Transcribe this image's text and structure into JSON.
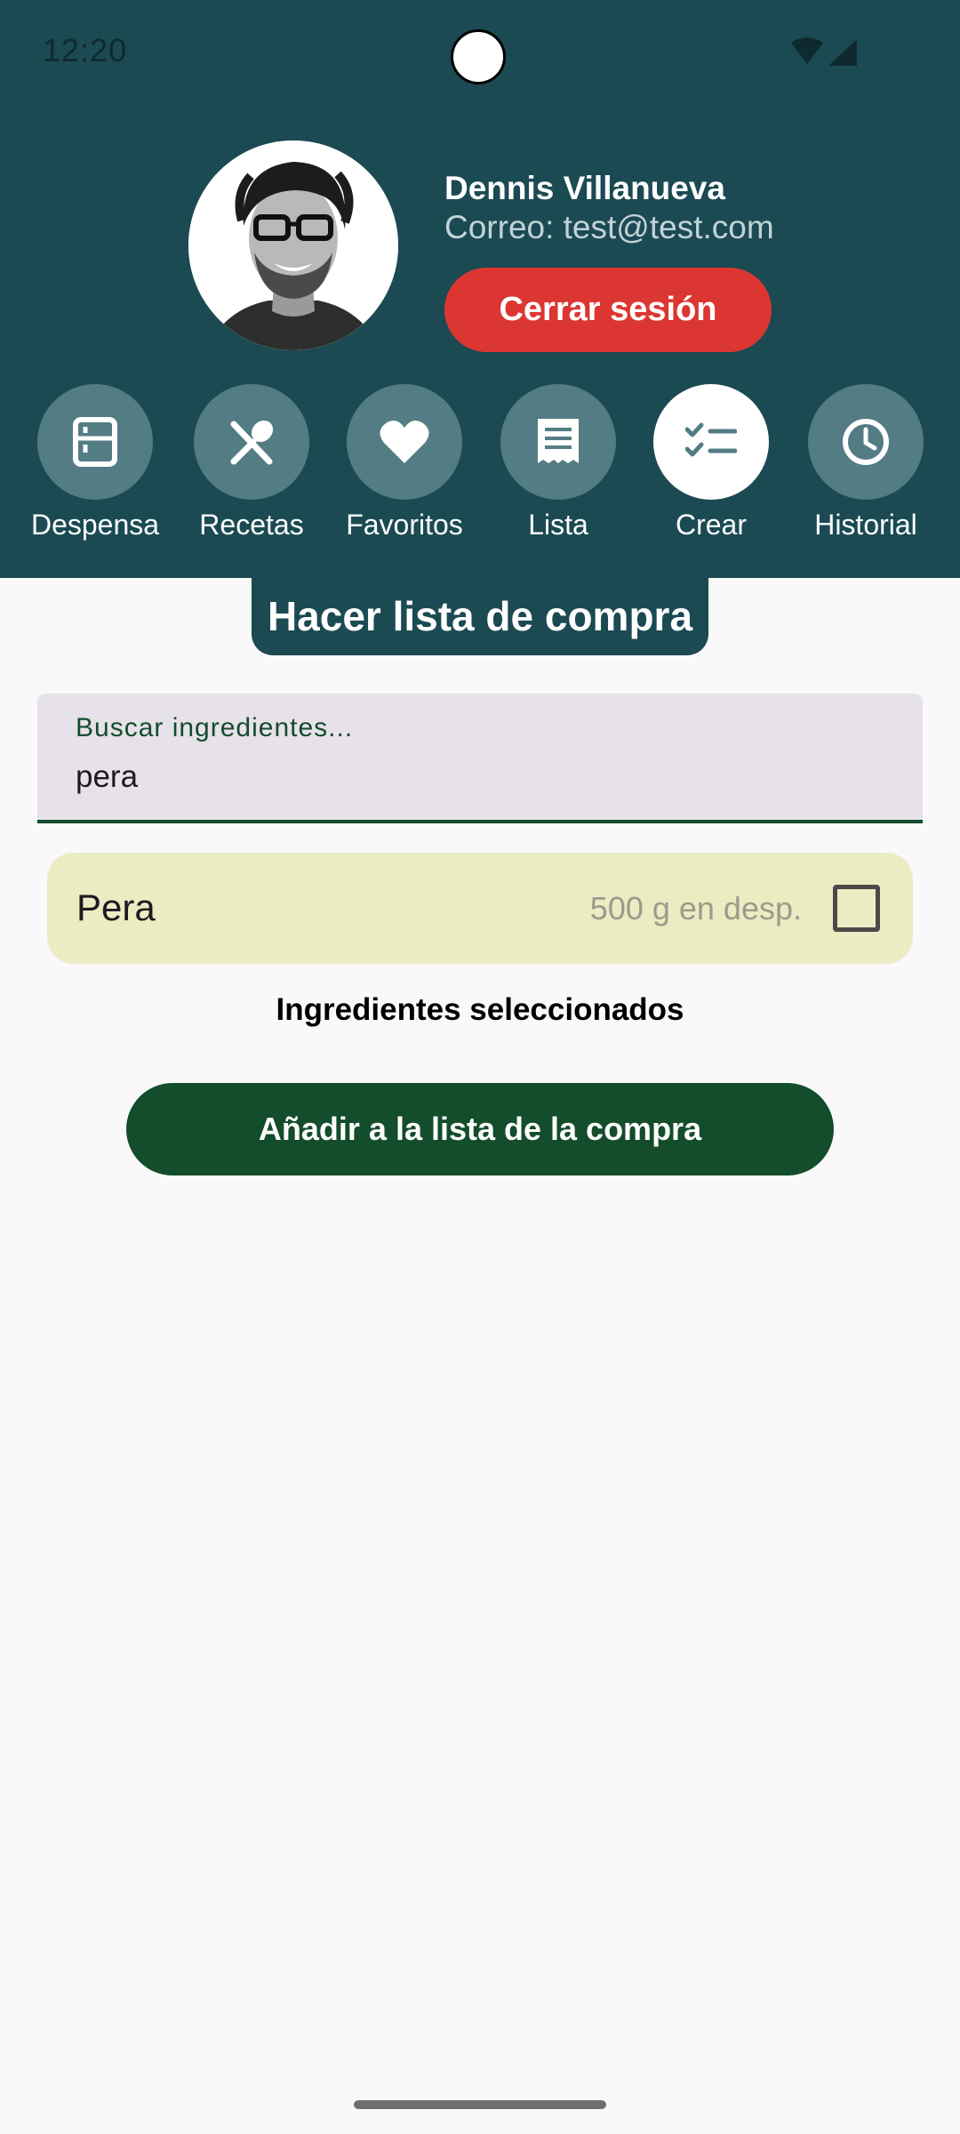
{
  "status_bar": {
    "time": "12:20",
    "icons": [
      "wifi-icon",
      "signal-icon"
    ]
  },
  "profile": {
    "name": "Dennis Villanueva",
    "email": "Correo: test@test.com",
    "logout_label": "Cerrar sesión",
    "logout_color": "#dc3632"
  },
  "nav": {
    "items": [
      {
        "label": "Despensa",
        "icon": "fridge-icon",
        "active": false
      },
      {
        "label": "Recetas",
        "icon": "utensils-icon",
        "active": false
      },
      {
        "label": "Favoritos",
        "icon": "heart-icon",
        "active": false
      },
      {
        "label": "Lista",
        "icon": "receipt-icon",
        "active": false
      },
      {
        "label": "Crear",
        "icon": "checklist-icon",
        "active": true
      },
      {
        "label": "Historial",
        "icon": "clock-icon",
        "active": false
      }
    ]
  },
  "page": {
    "title": "Hacer lista de compra"
  },
  "search": {
    "label": "Buscar ingredientes...",
    "value": "pera"
  },
  "results": [
    {
      "name": "Pera",
      "stock": "500 g en desp.",
      "checked": false
    }
  ],
  "selected": {
    "heading": "Ingredientes seleccionados"
  },
  "actions": {
    "add_label": "Añadir a la lista de la compra"
  },
  "colors": {
    "header_bg": "#1b4a53",
    "nav_circle": "#537c84",
    "primary_green": "#134d2b",
    "card_bg": "#ececc3",
    "logout_red": "#dc3632"
  }
}
